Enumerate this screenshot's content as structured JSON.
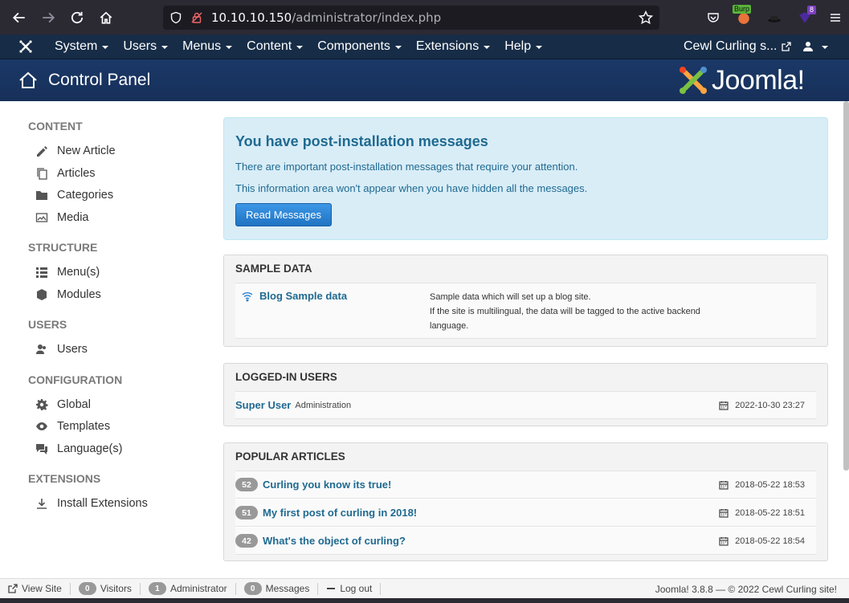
{
  "browser": {
    "url_host": "10.10.10.150",
    "url_path": "/administrator/index.php",
    "burp_label": "Burp",
    "ext_badge_count": "8"
  },
  "topnav": {
    "items": [
      {
        "label": "System"
      },
      {
        "label": "Users"
      },
      {
        "label": "Menus"
      },
      {
        "label": "Content"
      },
      {
        "label": "Components"
      },
      {
        "label": "Extensions"
      },
      {
        "label": "Help"
      }
    ],
    "site_link": "Cewl Curling s..."
  },
  "header": {
    "title": "Control Panel",
    "brand": "Joomla!"
  },
  "sidebar": {
    "sections": [
      {
        "heading": "CONTENT",
        "items": [
          {
            "label": "New Article",
            "icon": "pencil-icon"
          },
          {
            "label": "Articles",
            "icon": "stack-icon"
          },
          {
            "label": "Categories",
            "icon": "folder-icon"
          },
          {
            "label": "Media",
            "icon": "image-icon"
          }
        ]
      },
      {
        "heading": "STRUCTURE",
        "items": [
          {
            "label": "Menu(s)",
            "icon": "list-icon"
          },
          {
            "label": "Modules",
            "icon": "cube-icon"
          }
        ]
      },
      {
        "heading": "USERS",
        "items": [
          {
            "label": "Users",
            "icon": "users-icon"
          }
        ]
      },
      {
        "heading": "CONFIGURATION",
        "items": [
          {
            "label": "Global",
            "icon": "gear-icon"
          },
          {
            "label": "Templates",
            "icon": "eye-icon"
          },
          {
            "label": "Language(s)",
            "icon": "comments-icon"
          }
        ]
      },
      {
        "heading": "EXTENSIONS",
        "items": [
          {
            "label": "Install Extensions",
            "icon": "download-icon"
          }
        ]
      }
    ]
  },
  "alert": {
    "title": "You have post-installation messages",
    "line1": "There are important post-installation messages that require your attention.",
    "line2": "This information area won't appear when you have hidden all the messages.",
    "button": "Read Messages"
  },
  "sample_data": {
    "heading": "SAMPLE DATA",
    "title": "Blog Sample data",
    "desc1": "Sample data which will set up a blog site.",
    "desc2": "If the site is multilingual, the data will be tagged to the active backend",
    "desc3": "language."
  },
  "logged_in": {
    "heading": "LOGGED-IN USERS",
    "user": "Super User",
    "role": "Administration",
    "date": "2022-10-30 23:27"
  },
  "popular": {
    "heading": "POPULAR ARTICLES",
    "articles": [
      {
        "hits": "52",
        "title": "Curling you know its true!",
        "date": "2018-05-22 18:53"
      },
      {
        "hits": "51",
        "title": "My first post of curling in 2018!",
        "date": "2018-05-22 18:51"
      },
      {
        "hits": "42",
        "title": "What's the object of curling?",
        "date": "2018-05-22 18:54"
      }
    ]
  },
  "status": {
    "view_site": "View Site",
    "visitors_count": "0",
    "visitors": "Visitors",
    "admin_count": "1",
    "admin": "Administrator",
    "messages_count": "0",
    "messages": "Messages",
    "logout": "Log out",
    "copyright": "Joomla! 3.8.8 — © 2022 Cewl Curling site!"
  }
}
